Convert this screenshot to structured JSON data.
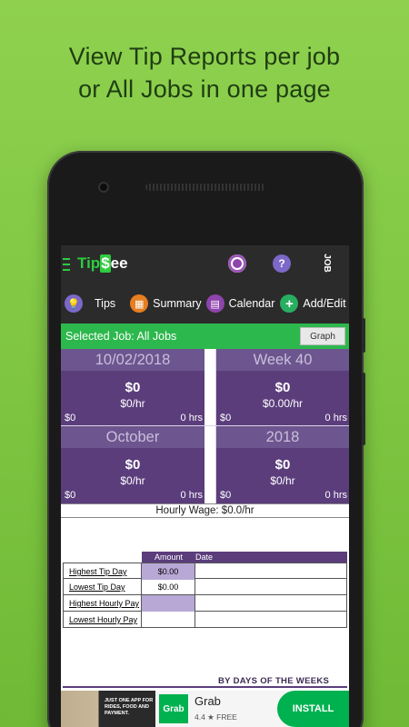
{
  "headline": {
    "line1": "View Tip Reports per job",
    "line2": "or All Jobs in one page"
  },
  "app": {
    "logo_left": "Tip",
    "logo_dollar": "$",
    "logo_right": "ee",
    "job_label": "JOB"
  },
  "nav": {
    "tips": "Tips",
    "summary": "Summary",
    "calendar": "Calendar",
    "add_edit": "Add/Edit"
  },
  "job_bar": {
    "text": "Selected Job: All Jobs",
    "graph_button": "Graph"
  },
  "cells": [
    {
      "head": "10/02/2018",
      "amount": "$0",
      "rate": "$0/hr",
      "left": "$0",
      "right": "0 hrs"
    },
    {
      "head": "Week 40",
      "amount": "$0",
      "rate": "$0.00/hr",
      "left": "$0",
      "right": "0 hrs"
    },
    {
      "head": "October",
      "amount": "$0",
      "rate": "$0/hr",
      "left": "$0",
      "right": "0 hrs"
    },
    {
      "head": "2018",
      "amount": "$0",
      "rate": "$0/hr",
      "left": "$0",
      "right": "0 hrs"
    }
  ],
  "hourly_wage": "Hourly Wage: $0.0/hr",
  "stats": {
    "col_amount": "Amount",
    "col_date": "Date",
    "rows": [
      {
        "label": "Highest Tip Day",
        "amount": "$0.00"
      },
      {
        "label": "Lowest Tip Day",
        "amount": "$0.00"
      },
      {
        "label": "Highest Hourly Pay",
        "amount": ""
      },
      {
        "label": "Lowest Hourly Pay",
        "amount": ""
      }
    ]
  },
  "days_label": "BY DAYS OF THE WEEKS",
  "ad": {
    "photo_text": "JUST ONE APP FOR RIDES, FOOD AND PAYMENT.",
    "logo": "Grab",
    "name": "Grab",
    "rating": "4.4 ★ FREE",
    "install": "INSTALL"
  }
}
